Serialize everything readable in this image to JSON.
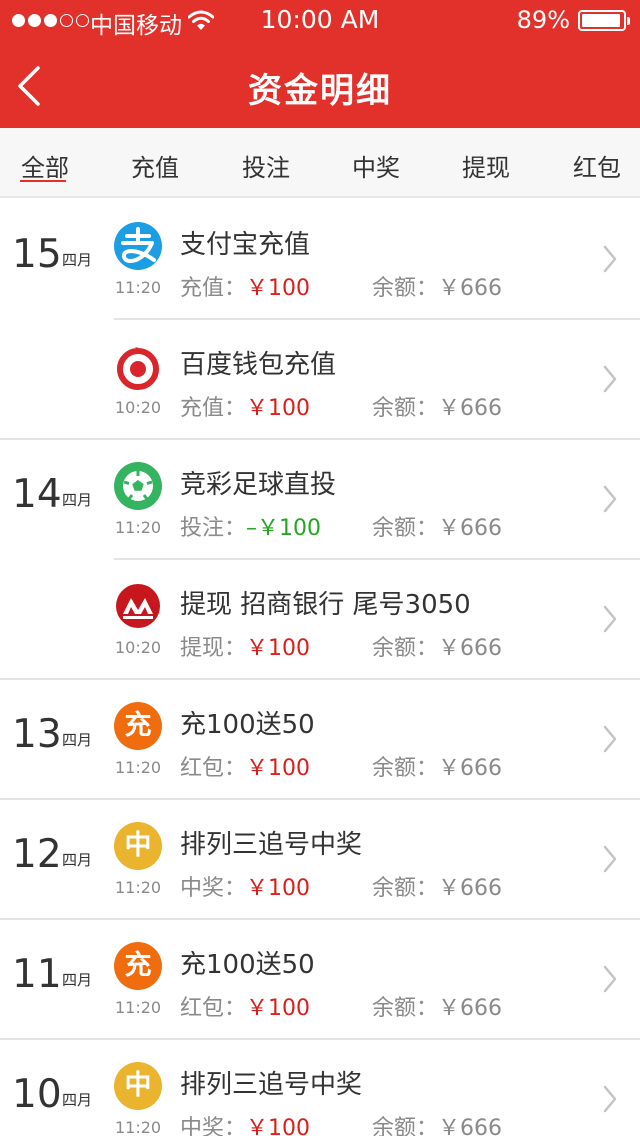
{
  "status": {
    "carrier": "中国移动",
    "time": "10:00 AM",
    "battery": "89%",
    "battery_level": 0.89,
    "signal_bars_filled": 3,
    "signal_bars_total": 5
  },
  "nav": {
    "title": "资金明细",
    "back_icon": "back-chevron-icon"
  },
  "tabs": [
    {
      "label": "全部",
      "active": true
    },
    {
      "label": "充值",
      "active": false
    },
    {
      "label": "投注",
      "active": false
    },
    {
      "label": "中奖",
      "active": false
    },
    {
      "label": "提现",
      "active": false
    },
    {
      "label": "红包",
      "active": false
    }
  ],
  "records": [
    {
      "day": "15",
      "month": "四月",
      "icon": "alipay-icon",
      "title": "支付宝充值",
      "time": "11:20",
      "type_label": "充值：",
      "amount": "￥100",
      "amount_color": "red",
      "balance": "余额：￥666"
    },
    {
      "day": "",
      "month": "",
      "icon": "baidu-wallet-icon",
      "title": "百度钱包充值",
      "time": "10:20",
      "type_label": "充值：",
      "amount": "￥100",
      "amount_color": "red",
      "balance": "余额：￥666"
    },
    {
      "day": "14",
      "month": "四月",
      "icon": "football-icon",
      "title": "竞彩足球直投",
      "time": "11:20",
      "type_label": "投注：",
      "amount": "–￥100",
      "amount_color": "green",
      "balance": "余额：￥666"
    },
    {
      "day": "",
      "month": "",
      "icon": "cmb-bank-icon",
      "title": "提现  招商银行  尾号3050",
      "time": "10:20",
      "type_label": "提现：",
      "amount": "￥100",
      "amount_color": "red",
      "balance": "余额：￥666"
    },
    {
      "day": "13",
      "month": "四月",
      "icon": "chong-badge-icon",
      "icon_text": "充",
      "title": "充100送50",
      "time": "11:20",
      "type_label": "红包：",
      "amount": "￥100",
      "amount_color": "red",
      "balance": "余额：￥666"
    },
    {
      "day": "12",
      "month": "四月",
      "icon": "zhong-badge-icon",
      "icon_text": "中",
      "title": "排列三追号中奖",
      "time": "11:20",
      "type_label": "中奖：",
      "amount": "￥100",
      "amount_color": "red",
      "balance": "余额：￥666"
    },
    {
      "day": "11",
      "month": "四月",
      "icon": "chong-badge-icon",
      "icon_text": "充",
      "title": "充100送50",
      "time": "11:20",
      "type_label": "红包：",
      "amount": "￥100",
      "amount_color": "red",
      "balance": "余额：￥666"
    },
    {
      "day": "10",
      "month": "四月",
      "icon": "zhong-badge-icon",
      "icon_text": "中",
      "title": "排列三追号中奖",
      "time": "11:20",
      "type_label": "中奖：",
      "amount": "￥100",
      "amount_color": "red",
      "balance": "余额：￥666"
    }
  ],
  "colors": {
    "brand": "#e1312a",
    "amount_red": "#d8201c",
    "amount_green": "#25a521"
  }
}
